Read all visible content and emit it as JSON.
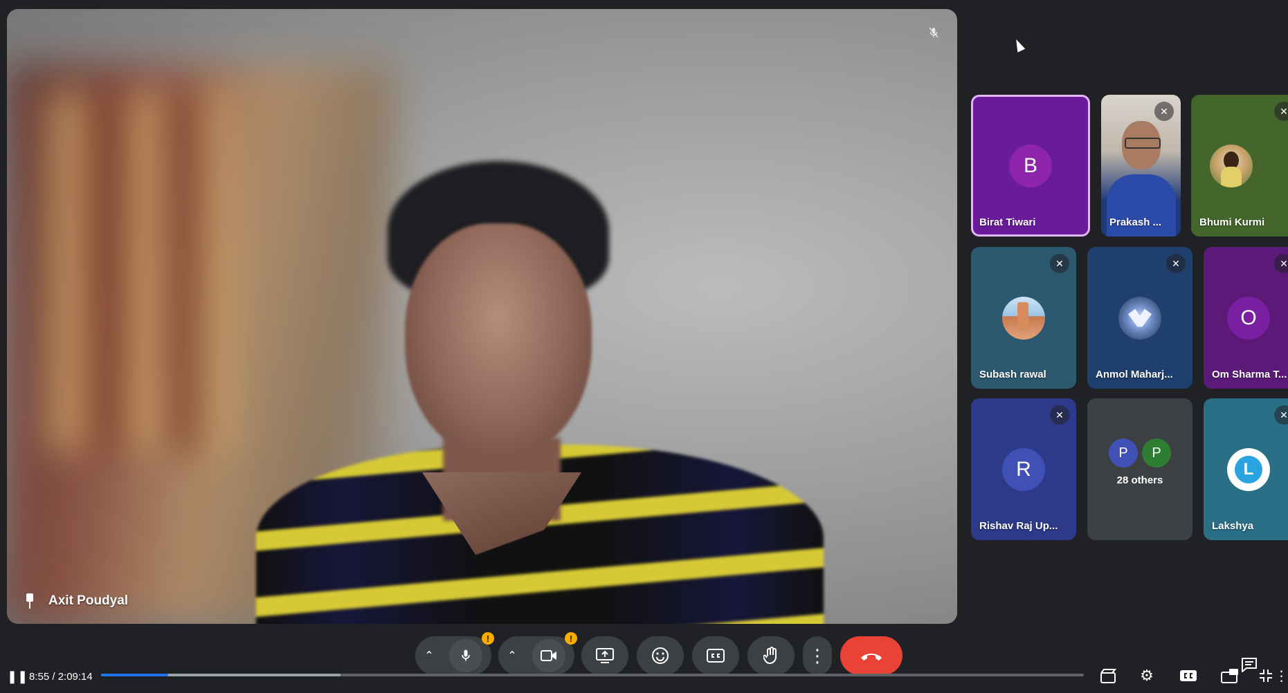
{
  "main_speaker": {
    "name": "Axit Poudyal"
  },
  "participants": [
    {
      "name": "Birat Tiwari",
      "initial": "B",
      "bg": "#6a1b9a",
      "avatar": "#8e24aa",
      "muted": false,
      "active_speaker": true
    },
    {
      "name": "Prakash ...",
      "initial": "",
      "bg": "#1f3a7a",
      "muted": true,
      "photo": true
    },
    {
      "name": "Bhumi Kurmi",
      "initial": "",
      "bg": "#44662c",
      "muted": true,
      "photo": true
    },
    {
      "name": "Subash rawal",
      "initial": "",
      "bg": "#2c5870",
      "muted": true,
      "photo": true
    },
    {
      "name": "Anmol Maharj...",
      "initial": "",
      "bg": "#1f3f6e",
      "muted": true,
      "photo": true
    },
    {
      "name": "Om Sharma T...",
      "initial": "O",
      "bg": "#5b1a78",
      "avatar": "#7b1fa2",
      "muted": true
    },
    {
      "name": "Rishav Raj Up...",
      "initial": "R",
      "bg": "#2d3a8a",
      "avatar": "#3f51b5",
      "muted": true
    },
    {
      "name": "Lakshya",
      "initial": "L",
      "bg": "#2a6f86",
      "muted": true,
      "logo": true
    }
  ],
  "others": {
    "label": "28 others",
    "avatars": [
      {
        "initial": "P",
        "color": "#3f51b5"
      },
      {
        "initial": "P",
        "color": "#2e7d32"
      }
    ]
  },
  "player": {
    "time": "8:55 / 2:09:14",
    "progress": 0.068,
    "buffered": 0.244
  },
  "icons": {
    "mic_warning": "!",
    "camera_warning": "!"
  },
  "colors": {
    "end_call": "#ea4335",
    "progress": "#1a73e8",
    "warning": "#f9ab00"
  }
}
